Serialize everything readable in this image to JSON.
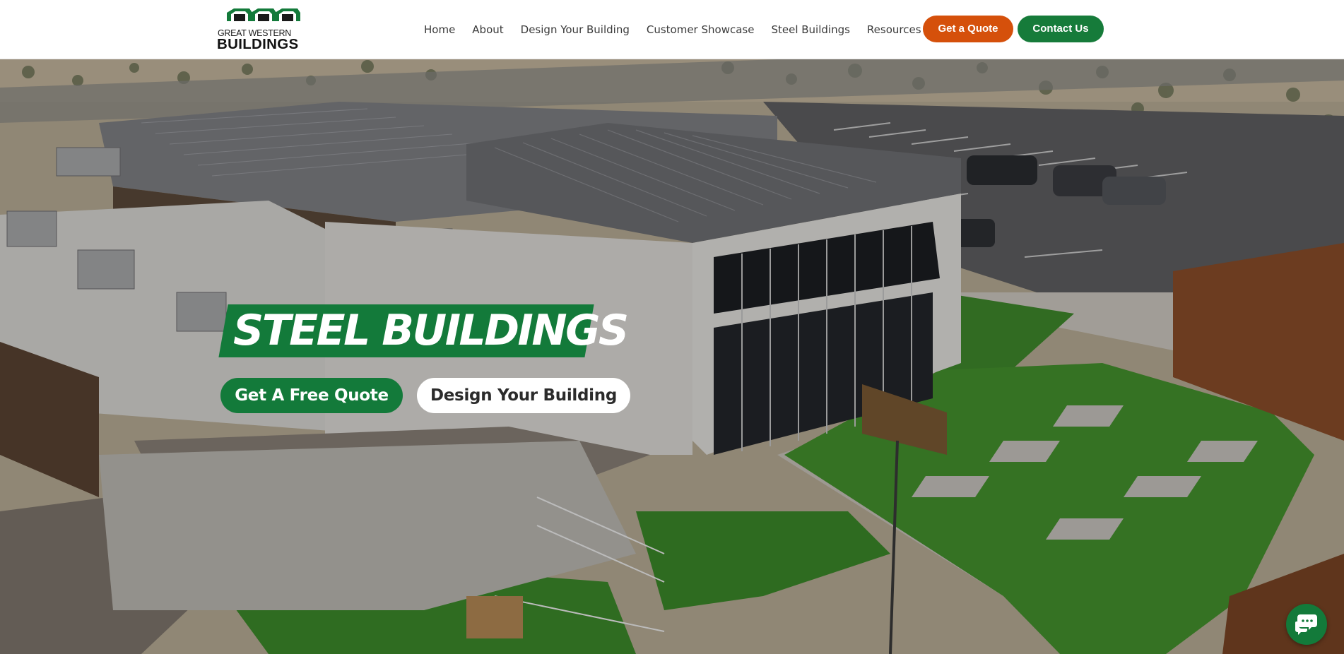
{
  "header": {
    "logo": {
      "line1": "GREAT WESTERN",
      "line2": "BUILDINGS",
      "green": "#137a3a"
    },
    "nav": [
      {
        "label": "Home"
      },
      {
        "label": "About"
      },
      {
        "label": "Design Your Building"
      },
      {
        "label": "Customer Showcase"
      },
      {
        "label": "Steel Buildings"
      },
      {
        "label": "Resources"
      }
    ],
    "quote_button": "Get a Quote",
    "contact_button": "Contact Us",
    "colors": {
      "quote": "#d5500b",
      "contact": "#167b3a"
    }
  },
  "hero": {
    "title": "STEEL BUILDINGS",
    "buttons": {
      "free_quote": "Get A Free Quote",
      "design": "Design Your Building"
    },
    "background_description_icon": "aerial-steel-building-photo"
  },
  "chat": {
    "icon": "chat-bubbles-icon"
  }
}
